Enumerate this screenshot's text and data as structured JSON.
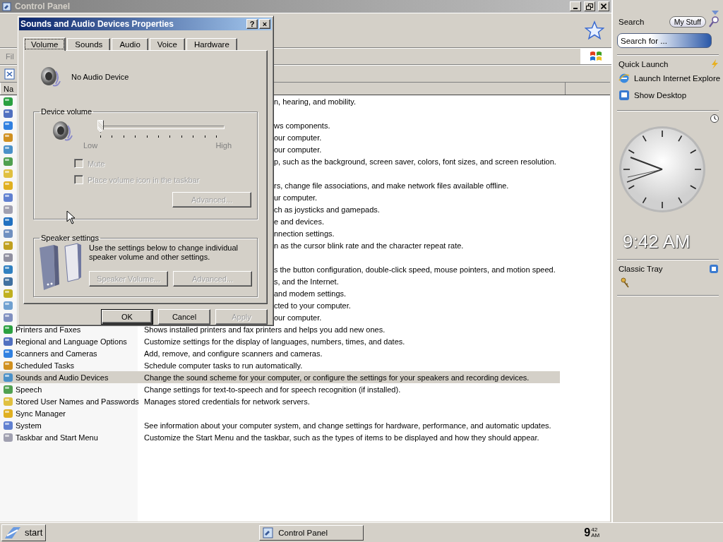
{
  "control_panel": {
    "title": "Control Panel",
    "menu_bar": [
      "Fil"
    ],
    "column_headers": [
      "Na"
    ],
    "rows": [
      {
        "kind": "covered",
        "description": "n, hearing, and mobility.",
        "selected": false
      },
      {
        "kind": "covered",
        "selected": false
      },
      {
        "kind": "covered",
        "description": "ws components.",
        "selected": false
      },
      {
        "kind": "covered",
        "description": "our computer.",
        "selected": false
      },
      {
        "kind": "covered",
        "description": "our computer.",
        "selected": false
      },
      {
        "kind": "covered",
        "description": "p, such as the background, screen saver, colors, font sizes, and screen resolution.",
        "selected": false
      },
      {
        "kind": "covered",
        "selected": false
      },
      {
        "kind": "covered",
        "description": "rs, change file associations, and make network files available offline.",
        "selected": false
      },
      {
        "kind": "covered",
        "description": "ur computer.",
        "selected": false
      },
      {
        "kind": "covered",
        "description": "ch as joysticks and gamepads.",
        "selected": false
      },
      {
        "kind": "covered",
        "description": "e and devices.",
        "selected": false
      },
      {
        "kind": "covered",
        "description": "nnection settings.",
        "selected": false
      },
      {
        "kind": "covered",
        "description": "n as the cursor blink rate and the character repeat rate.",
        "selected": false
      },
      {
        "kind": "covered",
        "selected": false
      },
      {
        "kind": "covered",
        "description": "s the button configuration, double-click speed, mouse pointers, and motion speed.",
        "selected": false
      },
      {
        "kind": "covered",
        "description": "s, and the Internet.",
        "selected": false
      },
      {
        "kind": "covered",
        "description": "and modem settings.",
        "selected": false
      },
      {
        "kind": "covered",
        "description": "cted to your computer.",
        "selected": false
      },
      {
        "kind": "covered",
        "description": "our computer.",
        "selected": false
      },
      {
        "kind": "full",
        "name": "Printers and Faxes",
        "description": "Shows installed printers and fax printers and helps you add new ones.",
        "selected": false
      },
      {
        "kind": "full",
        "name": "Regional and Language Options",
        "description": "Customize settings for the display of languages, numbers, times, and dates.",
        "selected": false
      },
      {
        "kind": "full",
        "name": "Scanners and Cameras",
        "description": "Add, remove, and configure scanners and cameras.",
        "selected": false
      },
      {
        "kind": "full",
        "name": "Scheduled Tasks",
        "description": "Schedule computer tasks to run automatically.",
        "selected": false
      },
      {
        "kind": "full",
        "name": "Sounds and Audio Devices",
        "description": "Change the sound scheme for your computer, or configure the settings for your speakers and recording devices.",
        "selected": true
      },
      {
        "kind": "full",
        "name": "Speech",
        "description": "Change settings for text-to-speech and for speech recognition (if installed).",
        "selected": false
      },
      {
        "kind": "full",
        "name": "Stored User Names and Passwords",
        "description": "Manages stored credentials for network servers.",
        "selected": false
      },
      {
        "kind": "full",
        "name": "Sync Manager",
        "selected": false
      },
      {
        "kind": "full",
        "name": "System",
        "description": "See information about your computer system, and change settings for hardware, performance, and automatic updates.",
        "selected": false
      },
      {
        "kind": "full",
        "name": "Taskbar and Start Menu",
        "description": "Customize the Start Menu and the taskbar, such as the types of items to be displayed and how they should appear.",
        "selected": false
      }
    ]
  },
  "dialog": {
    "title": "Sounds and Audio Devices Properties",
    "help": "?",
    "close": "×",
    "tabs": [
      {
        "label": "Volume",
        "selected": true
      },
      {
        "label": "Sounds",
        "selected": false
      },
      {
        "label": "Audio",
        "selected": false
      },
      {
        "label": "Voice",
        "selected": false
      },
      {
        "label": "Hardware",
        "selected": false
      }
    ],
    "device_name": "No Audio Device",
    "device_volume": {
      "title": "Device volume",
      "level": 0,
      "low_label": "Low",
      "high_label": "High",
      "checkboxes": [
        {
          "label": "Mute",
          "checked": false,
          "disabled": true
        },
        {
          "label": "Place volume icon in the taskbar",
          "checked": false,
          "disabled": true
        }
      ],
      "advanced_button": {
        "label": "Advanced...",
        "disabled": true
      }
    },
    "speaker_settings": {
      "title": "Speaker settings",
      "text": "Use the settings below to change individual speaker volume and other settings.",
      "buttons": [
        {
          "label": "Speaker Volume...",
          "disabled": true
        },
        {
          "label": "Advanced...",
          "disabled": true
        }
      ]
    },
    "buttons": [
      {
        "label": "OK",
        "disabled": false
      },
      {
        "label": "Cancel",
        "disabled": false
      },
      {
        "label": "Apply",
        "disabled": true
      }
    ]
  },
  "sidebar": {
    "search": {
      "title": "Search",
      "my_stuff": "My Stuff",
      "placeholder": "Search for ..."
    },
    "quick_launch": {
      "title": "Quick Launch",
      "items": [
        "Launch Internet Explore",
        "Show Desktop"
      ]
    },
    "clock": {
      "time": "9:42 AM"
    },
    "classic_tray": {
      "title": "Classic Tray"
    }
  },
  "taskbar": {
    "start": "start",
    "tasks": [
      "Control Panel"
    ],
    "clock": {
      "hour": "9",
      "minute": "42",
      "ampm": "AM"
    }
  }
}
